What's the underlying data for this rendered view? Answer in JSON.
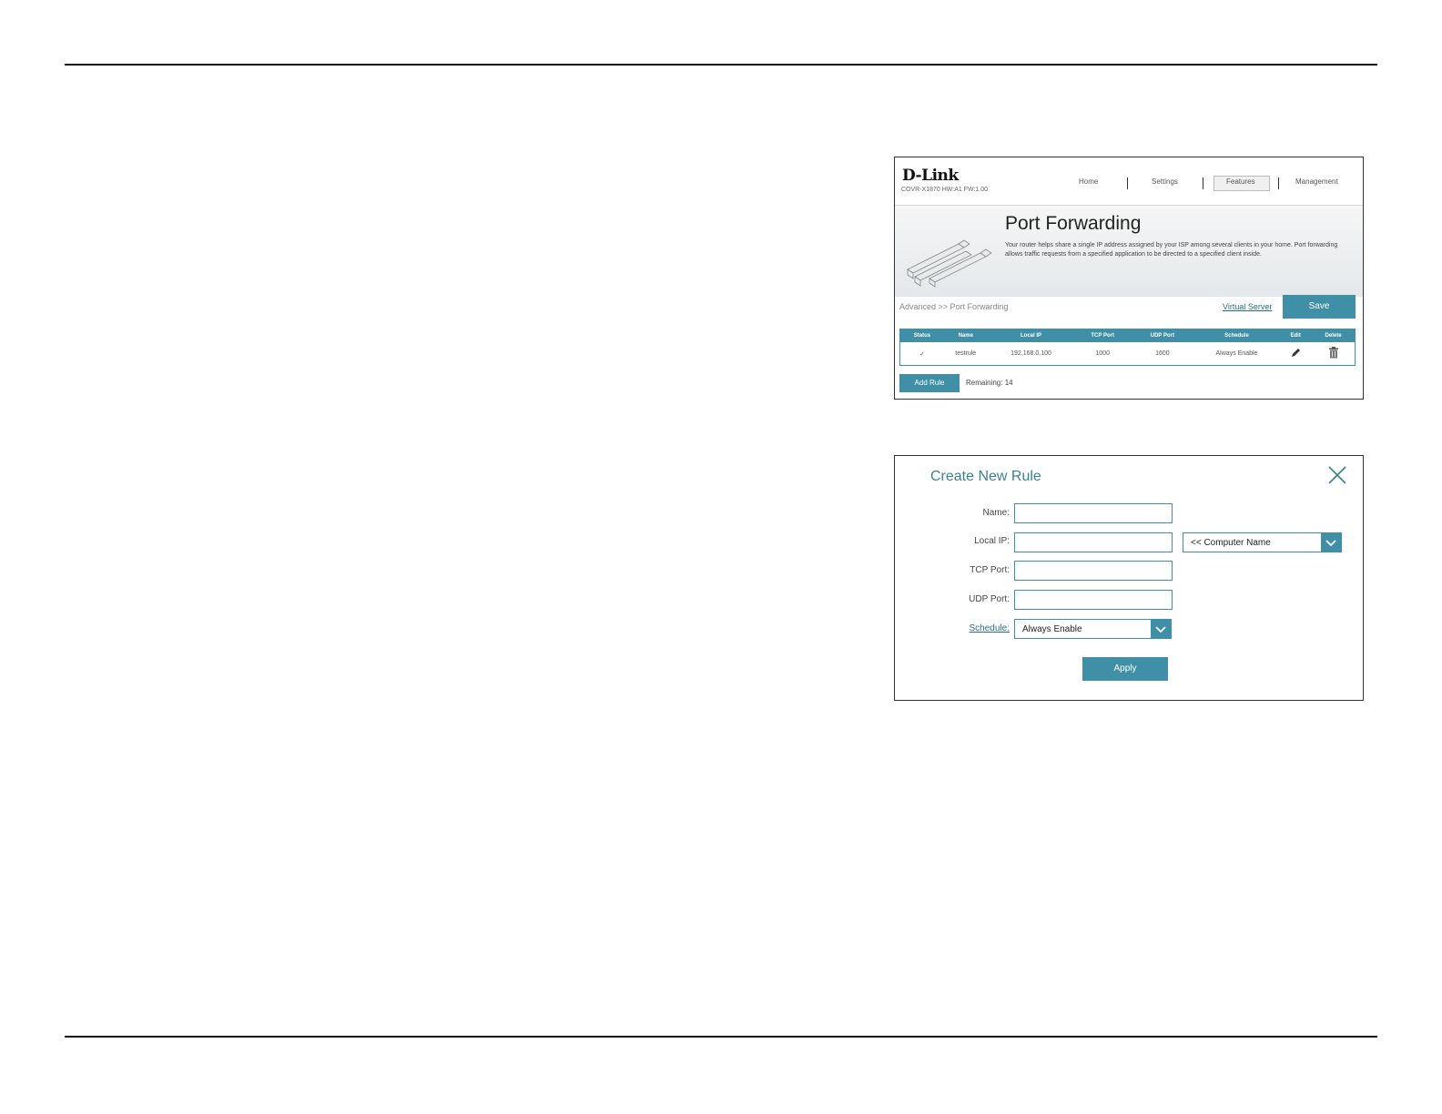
{
  "port_forwarding": {
    "brand": "D-Link",
    "model": "COVR-X1870 HW:A1 FW:1.00",
    "nav": [
      "Home",
      "Settings",
      "Features",
      "Management"
    ],
    "active_tab": "Features",
    "title": "Port Forwarding",
    "description": "Your router helps share a single IP address assigned by your ISP among several clients in your home. Port forwarding allows traffic requests from a specified application to be directed to a specified client inside.",
    "breadcrumb": "Advanced >> Port Forwarding",
    "virtual_server_link": "Virtual Server",
    "save_label": "Save",
    "table": {
      "headers": [
        "Status",
        "Name",
        "Local IP",
        "TCP Port",
        "UDP Port",
        "Schedule",
        "Edit",
        "Delete"
      ],
      "rows": [
        {
          "status": "✓",
          "name": "testrule",
          "local_ip": "192.168.0.100",
          "tcp_port": "1000",
          "udp_port": "1600",
          "schedule": "Always Enable"
        }
      ]
    },
    "add_rule_label": "Add Rule",
    "remaining": "Remaining: 14"
  },
  "create_rule": {
    "title": "Create New Rule",
    "labels": {
      "name": "Name:",
      "local_ip": "Local IP:",
      "tcp_port": "TCP Port:",
      "udp_port": "UDP Port:",
      "schedule": "Schedule:"
    },
    "computer_name_select": "<< Computer Name",
    "schedule_select": "Always Enable",
    "apply_label": "Apply"
  }
}
